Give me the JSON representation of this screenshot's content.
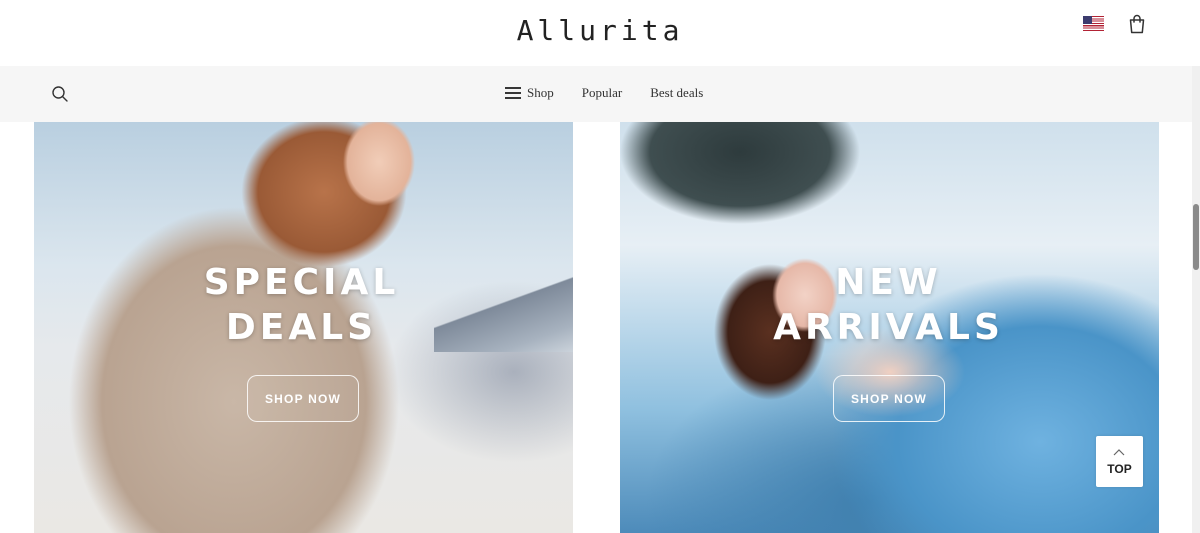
{
  "header": {
    "logo_text": "Allurita",
    "flag_icon": "us-flag-icon",
    "cart_icon": "shopping-bag-icon"
  },
  "nav": {
    "search_icon": "search-icon",
    "items": [
      {
        "label": "Shop",
        "icon": "menu-icon"
      },
      {
        "label": "Popular"
      },
      {
        "label": "Best deals"
      }
    ]
  },
  "banners": [
    {
      "title_line1": "SPECIAL",
      "title_line2": "DEALS",
      "button_label": "SHOP NOW"
    },
    {
      "title_line1": "NEW",
      "title_line2": "ARRIVALS",
      "button_label": "SHOP NOW"
    }
  ],
  "back_to_top": {
    "label": "TOP",
    "icon": "chevron-up-icon"
  }
}
